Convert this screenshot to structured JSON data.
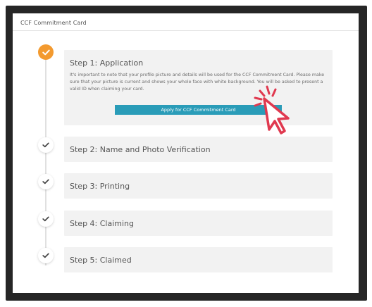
{
  "card": {
    "title": "CCF Commitment Card"
  },
  "steps": [
    {
      "label": "Step 1: Application",
      "status": "active",
      "description": "It's important to note that your profile picture and details will be used for the CCF Commitment Card. Please make sure that your picture is current and shows your whole face with white background. You will be asked to present a valid ID when claiming your card.",
      "button_label": "Apply for CCF Commitment Card"
    },
    {
      "label": "Step 2: Name and Photo Verification",
      "status": "pending"
    },
    {
      "label": "Step 3: Printing",
      "status": "pending"
    },
    {
      "label": "Step 4: Claiming",
      "status": "pending"
    },
    {
      "label": "Step 5: Claimed",
      "status": "pending"
    }
  ],
  "icons": {
    "active_marker": "check-icon",
    "pending_marker": "check-icon",
    "pointer": "pointer-click-icon"
  },
  "colors": {
    "frame": "#262626",
    "active_marker": "#f39a2f",
    "button": "#2a9cb8",
    "step_box": "#f2f2f2",
    "cursor": "#e0394f"
  }
}
